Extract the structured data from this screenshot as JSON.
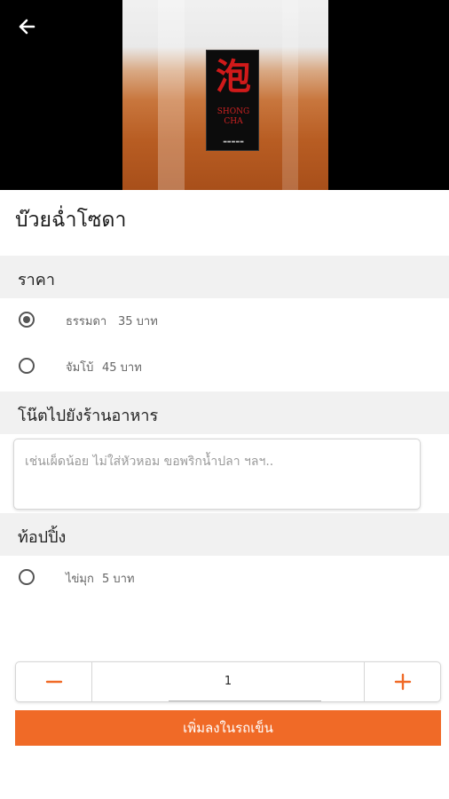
{
  "hero": {
    "product_image_alt": "drink-cup-image",
    "label_char": "泡",
    "label_brand_line1": "SHONG",
    "label_brand_line2": "CHA"
  },
  "header": {
    "back_icon": "arrow-left-icon"
  },
  "product": {
    "title": "บ๊วยฉ่ำโซดา"
  },
  "price_section": {
    "heading": "ราคา",
    "options": [
      {
        "name": "ธรรมดา",
        "price": "35 บาท",
        "selected": true
      },
      {
        "name": "จัมโบ้",
        "price": "45 บาท",
        "selected": false
      }
    ]
  },
  "note_section": {
    "heading": "โน๊ตไปยังร้านอาหาร",
    "placeholder": "เช่นเผ็ดน้อย ไม่ใส่หัวหอม ขอพริกน้ำปลา ฯลฯ.."
  },
  "topping_section": {
    "heading": "ท้อปปิ้ง",
    "options": [
      {
        "name": "ไข่มุก",
        "price": "5 บาท",
        "selected": false
      }
    ]
  },
  "quantity": {
    "value": "1",
    "minus_icon": "minus-icon",
    "plus_icon": "plus-icon"
  },
  "cart": {
    "add_label": "เพิ่มลงในรถเข็น"
  },
  "colors": {
    "accent": "#f06a27",
    "section_bg": "#f1f1f1"
  }
}
